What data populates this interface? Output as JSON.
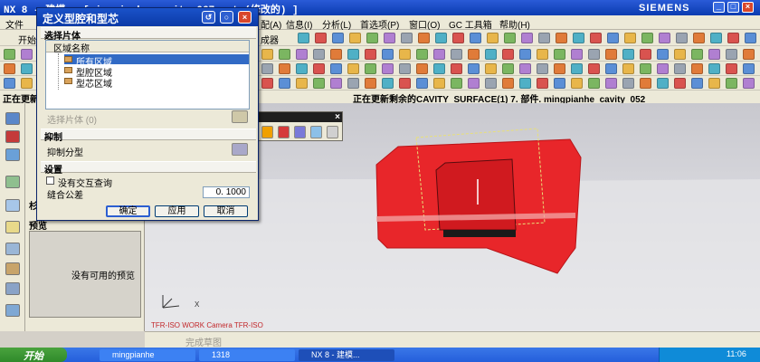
{
  "app": {
    "title": "NX 8 - 建模 - [mingpianhe_cavity_067.prt  (修改的) ]",
    "brand": "SIEMENS"
  },
  "menu": {
    "file_partial": "文件",
    "visible_items": [
      "配(A)",
      "信息(I)",
      "分析(L)",
      "首选项(P)",
      "窗口(O)",
      "GC 工具箱",
      "帮助(H)"
    ],
    "toolbar_texts": [
      "开始",
      "成器"
    ]
  },
  "status": {
    "left": "正在更新",
    "right": "正在更新剩余的CAVITY_SURFACE(1) 7. 部件. mingpianhe_cavity_052"
  },
  "dialog": {
    "title": "定义型腔和型芯",
    "sections": {
      "select_sheet": "选择片体",
      "suppress": "抑制",
      "settings": "设置"
    },
    "region_list": {
      "header": "区域名称",
      "items": [
        {
          "label": "所有区域",
          "selected": true
        },
        {
          "label": "型腔区域",
          "selected": false
        },
        {
          "label": "型芯区域",
          "selected": false
        }
      ]
    },
    "select_sheet_label": "选择片体 (0)",
    "suppress_label": "抑制分型",
    "no_interaction_label": "没有交互查询",
    "no_interaction_checked": false,
    "tolerance_label": "缝合公差",
    "tolerance_value": "0. 1000",
    "buttons": {
      "ok": "确定",
      "apply": "应用",
      "cancel": "取消"
    }
  },
  "nav_panel": {
    "preview_header": "预览",
    "no_preview": "没有可用的预览",
    "tab_fragment": "杉"
  },
  "graphics": {
    "view_label": "TFR-ISO WORK Camera TFR-ISO",
    "model_color": "#e8262a",
    "axis_x": "X"
  },
  "bottom_toolbar": {
    "grayed_text": "完成草图"
  },
  "taskbar": {
    "start": "开始",
    "tasks": [
      "mingpianhe",
      "1318",
      "NX 8 - 建模..."
    ],
    "clock": "11:06"
  }
}
